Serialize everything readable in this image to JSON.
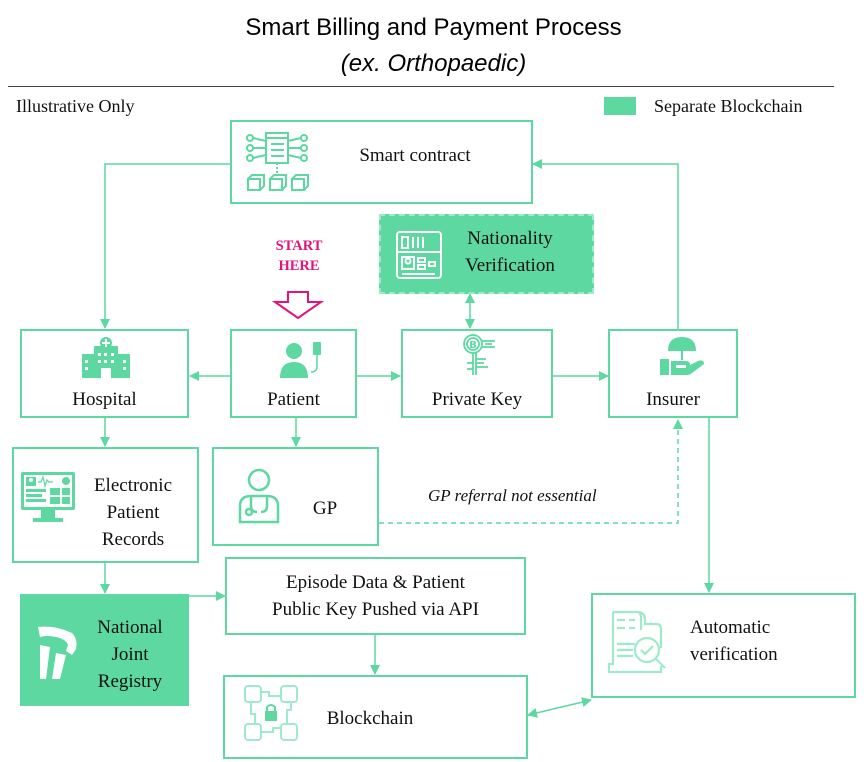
{
  "header": {
    "title": "Smart Billing and Payment Process",
    "subtitle": "(ex. Orthopaedic)",
    "illustrative_note": "Illustrative Only"
  },
  "legend": {
    "label": "Separate Blockchain",
    "color": "#5cd8a0"
  },
  "colors": {
    "accent": "#5cd8a0",
    "start": "#e2137a"
  },
  "start_marker": {
    "line1": "START",
    "line2": "HERE"
  },
  "nodes": {
    "smart_contract": {
      "label": "Smart contract",
      "icon": "smart-contract-icon"
    },
    "nationality": {
      "line1": "Nationality",
      "line2": "Verification",
      "icon": "id-card-icon",
      "separate_blockchain": true
    },
    "hospital": {
      "label": "Hospital",
      "icon": "hospital-icon"
    },
    "patient": {
      "label": "Patient",
      "icon": "patient-icon"
    },
    "private_key": {
      "label": "Private Key",
      "icon": "crypto-key-icon"
    },
    "insurer": {
      "label": "Insurer",
      "icon": "insurance-umbrella-hand-icon"
    },
    "epr": {
      "line1": "Electronic",
      "line2": "Patient",
      "line3": "Records",
      "icon": "monitor-records-icon"
    },
    "gp": {
      "label": "GP",
      "icon": "doctor-icon"
    },
    "njr": {
      "line1": "National",
      "line2": "Joint",
      "line3": "Registry",
      "icon": "knee-joint-icon",
      "separate_blockchain": true
    },
    "episode": {
      "line1": "Episode Data & Patient",
      "line2": "Public Key Pushed via API"
    },
    "blockchain": {
      "label": "Blockchain",
      "icon": "blockchain-lock-icon"
    },
    "auto_verify": {
      "line1": "Automatic",
      "line2": "verification",
      "icon": "document-check-icon"
    }
  },
  "annotations": {
    "gp_referral": "GP referral not essential"
  }
}
